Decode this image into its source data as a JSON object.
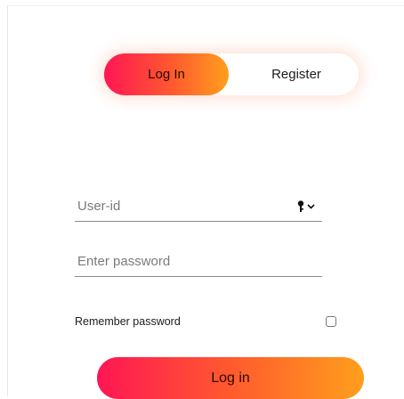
{
  "tabs": {
    "login_label": "Log In",
    "register_label": "Register",
    "active": "login"
  },
  "form": {
    "userid_placeholder": "User-id",
    "userid_value": "",
    "password_placeholder": "Enter password",
    "password_value": "",
    "key_icon": "key-icon",
    "dropdown_icon": "chevron-down-icon",
    "remember_label": "Remember password",
    "remember_checked": false,
    "submit_label": "Log in"
  },
  "colors": {
    "gradient_start": "#ff1654",
    "gradient_mid": "#ff5a2e",
    "gradient_end": "#ff9f1c",
    "field_underline": "#8c8c8c",
    "placeholder": "#7b7b7b"
  }
}
